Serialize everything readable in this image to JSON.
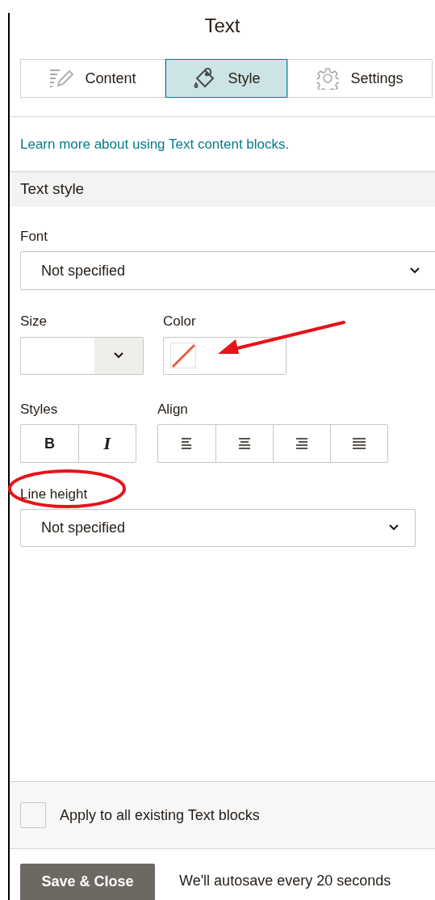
{
  "title": "Text",
  "tabs": [
    {
      "label": "Content",
      "selected": false
    },
    {
      "label": "Style",
      "selected": true
    },
    {
      "label": "Settings",
      "selected": false
    }
  ],
  "help_link": "Learn more about using Text content blocks.",
  "section": "Text style",
  "font": {
    "label": "Font",
    "value": "Not specified"
  },
  "size": {
    "label": "Size"
  },
  "color": {
    "label": "Color"
  },
  "styles": {
    "label": "Styles",
    "buttons": [
      "B",
      "I"
    ]
  },
  "align": {
    "label": "Align"
  },
  "line_height": {
    "label": "Line height",
    "value": "Not specified"
  },
  "apply_all": {
    "label": "Apply to all existing Text blocks",
    "checked": false
  },
  "save_button": "Save & Close",
  "autosave_note": "We'll autosave every 20 seconds"
}
